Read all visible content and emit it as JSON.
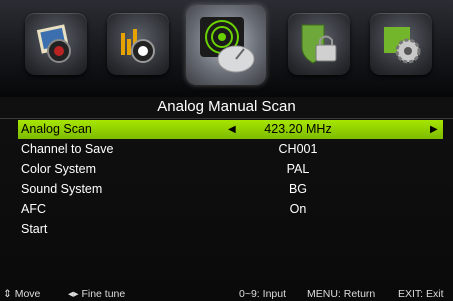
{
  "menu": {
    "tabs": [
      {
        "icon": "picture-icon"
      },
      {
        "icon": "sound-icon"
      },
      {
        "icon": "channel-icon"
      },
      {
        "icon": "lock-icon"
      },
      {
        "icon": "setup-icon"
      }
    ],
    "selected_tab_index": 2
  },
  "panel": {
    "title": "Analog Manual Scan",
    "rows": [
      {
        "label": "Analog Scan",
        "value": "423.20 MHz"
      },
      {
        "label": "Channel to Save",
        "value": "CH001"
      },
      {
        "label": "Color System",
        "value": "PAL"
      },
      {
        "label": "Sound System",
        "value": "BG"
      },
      {
        "label": "AFC",
        "value": "On"
      },
      {
        "label": "Start",
        "value": ""
      }
    ],
    "arrow_left": "◀",
    "arrow_right": "▶"
  },
  "footer": {
    "move": "⇕ Move",
    "fine_tune": "◂▸ Fine tune",
    "input": "0~9: Input",
    "menu": "MENU: Return",
    "exit": "EXIT: Exit"
  },
  "colors": {
    "accent": "#96d400",
    "background": "#000000"
  }
}
